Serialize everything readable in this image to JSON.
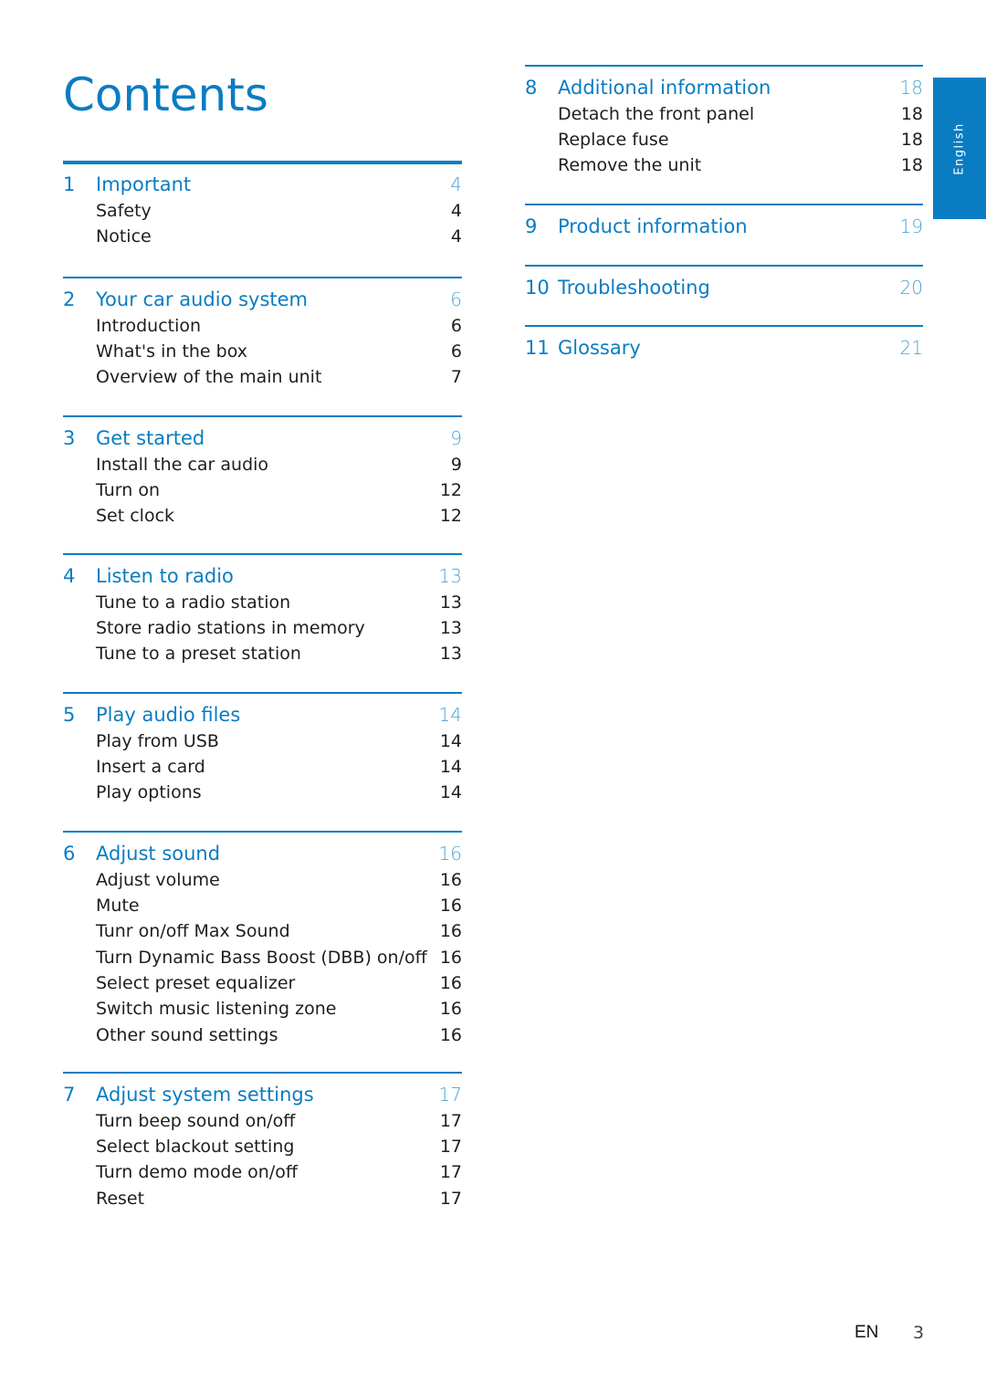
{
  "page": {
    "title": "Contents",
    "language_tab": "English",
    "footer": {
      "lang_code": "EN",
      "page_number": "3"
    }
  },
  "accent_color": "#0a7cc2",
  "sections": [
    {
      "number": "1",
      "title": "Important",
      "page": "4",
      "items": [
        {
          "label": "Safety",
          "page": "4"
        },
        {
          "label": "Notice",
          "page": "4"
        }
      ]
    },
    {
      "number": "2",
      "title": "Your car audio system",
      "page": "6",
      "items": [
        {
          "label": "Introduction",
          "page": "6"
        },
        {
          "label": "What's in the box",
          "page": "6"
        },
        {
          "label": "Overview of the main unit",
          "page": "7"
        }
      ]
    },
    {
      "number": "3",
      "title": "Get started",
      "page": "9",
      "items": [
        {
          "label": "Install the car audio",
          "page": "9"
        },
        {
          "label": "Turn on",
          "page": "12"
        },
        {
          "label": "Set clock",
          "page": "12"
        }
      ]
    },
    {
      "number": "4",
      "title": "Listen to radio",
      "page": "13",
      "items": [
        {
          "label": "Tune to a radio station",
          "page": "13"
        },
        {
          "label": "Store radio stations in memory",
          "page": "13"
        },
        {
          "label": "Tune to a preset station",
          "page": "13"
        }
      ]
    },
    {
      "number": "5",
      "title": "Play audio files",
      "page": "14",
      "items": [
        {
          "label": "Play from USB",
          "page": "14"
        },
        {
          "label": "Insert a card",
          "page": "14"
        },
        {
          "label": "Play options",
          "page": "14"
        }
      ]
    },
    {
      "number": "6",
      "title": "Adjust sound",
      "page": "16",
      "items": [
        {
          "label": "Adjust volume",
          "page": "16"
        },
        {
          "label": "Mute",
          "page": "16"
        },
        {
          "label": "Tunr on/off Max Sound",
          "page": "16"
        },
        {
          "label": "Turn Dynamic Bass Boost (DBB) on/off",
          "page": "16"
        },
        {
          "label": "Select preset equalizer",
          "page": "16"
        },
        {
          "label": "Switch music listening zone",
          "page": "16"
        },
        {
          "label": "Other sound settings",
          "page": "16"
        }
      ]
    },
    {
      "number": "7",
      "title": "Adjust system settings",
      "page": "17",
      "items": [
        {
          "label": "Turn beep sound on/off",
          "page": "17"
        },
        {
          "label": "Select blackout setting",
          "page": "17"
        },
        {
          "label": "Turn demo mode on/off",
          "page": "17"
        },
        {
          "label": "Reset",
          "page": "17"
        }
      ]
    },
    {
      "number": "8",
      "title": "Additional information",
      "page": "18",
      "items": [
        {
          "label": "Detach the front panel",
          "page": "18"
        },
        {
          "label": "Replace fuse",
          "page": "18"
        },
        {
          "label": "Remove the unit",
          "page": "18"
        }
      ]
    },
    {
      "number": "9",
      "title": "Product information",
      "page": "19",
      "items": []
    },
    {
      "number": "10",
      "title": "Troubleshooting",
      "page": "20",
      "items": []
    },
    {
      "number": "11",
      "title": "Glossary",
      "page": "21",
      "items": []
    }
  ]
}
